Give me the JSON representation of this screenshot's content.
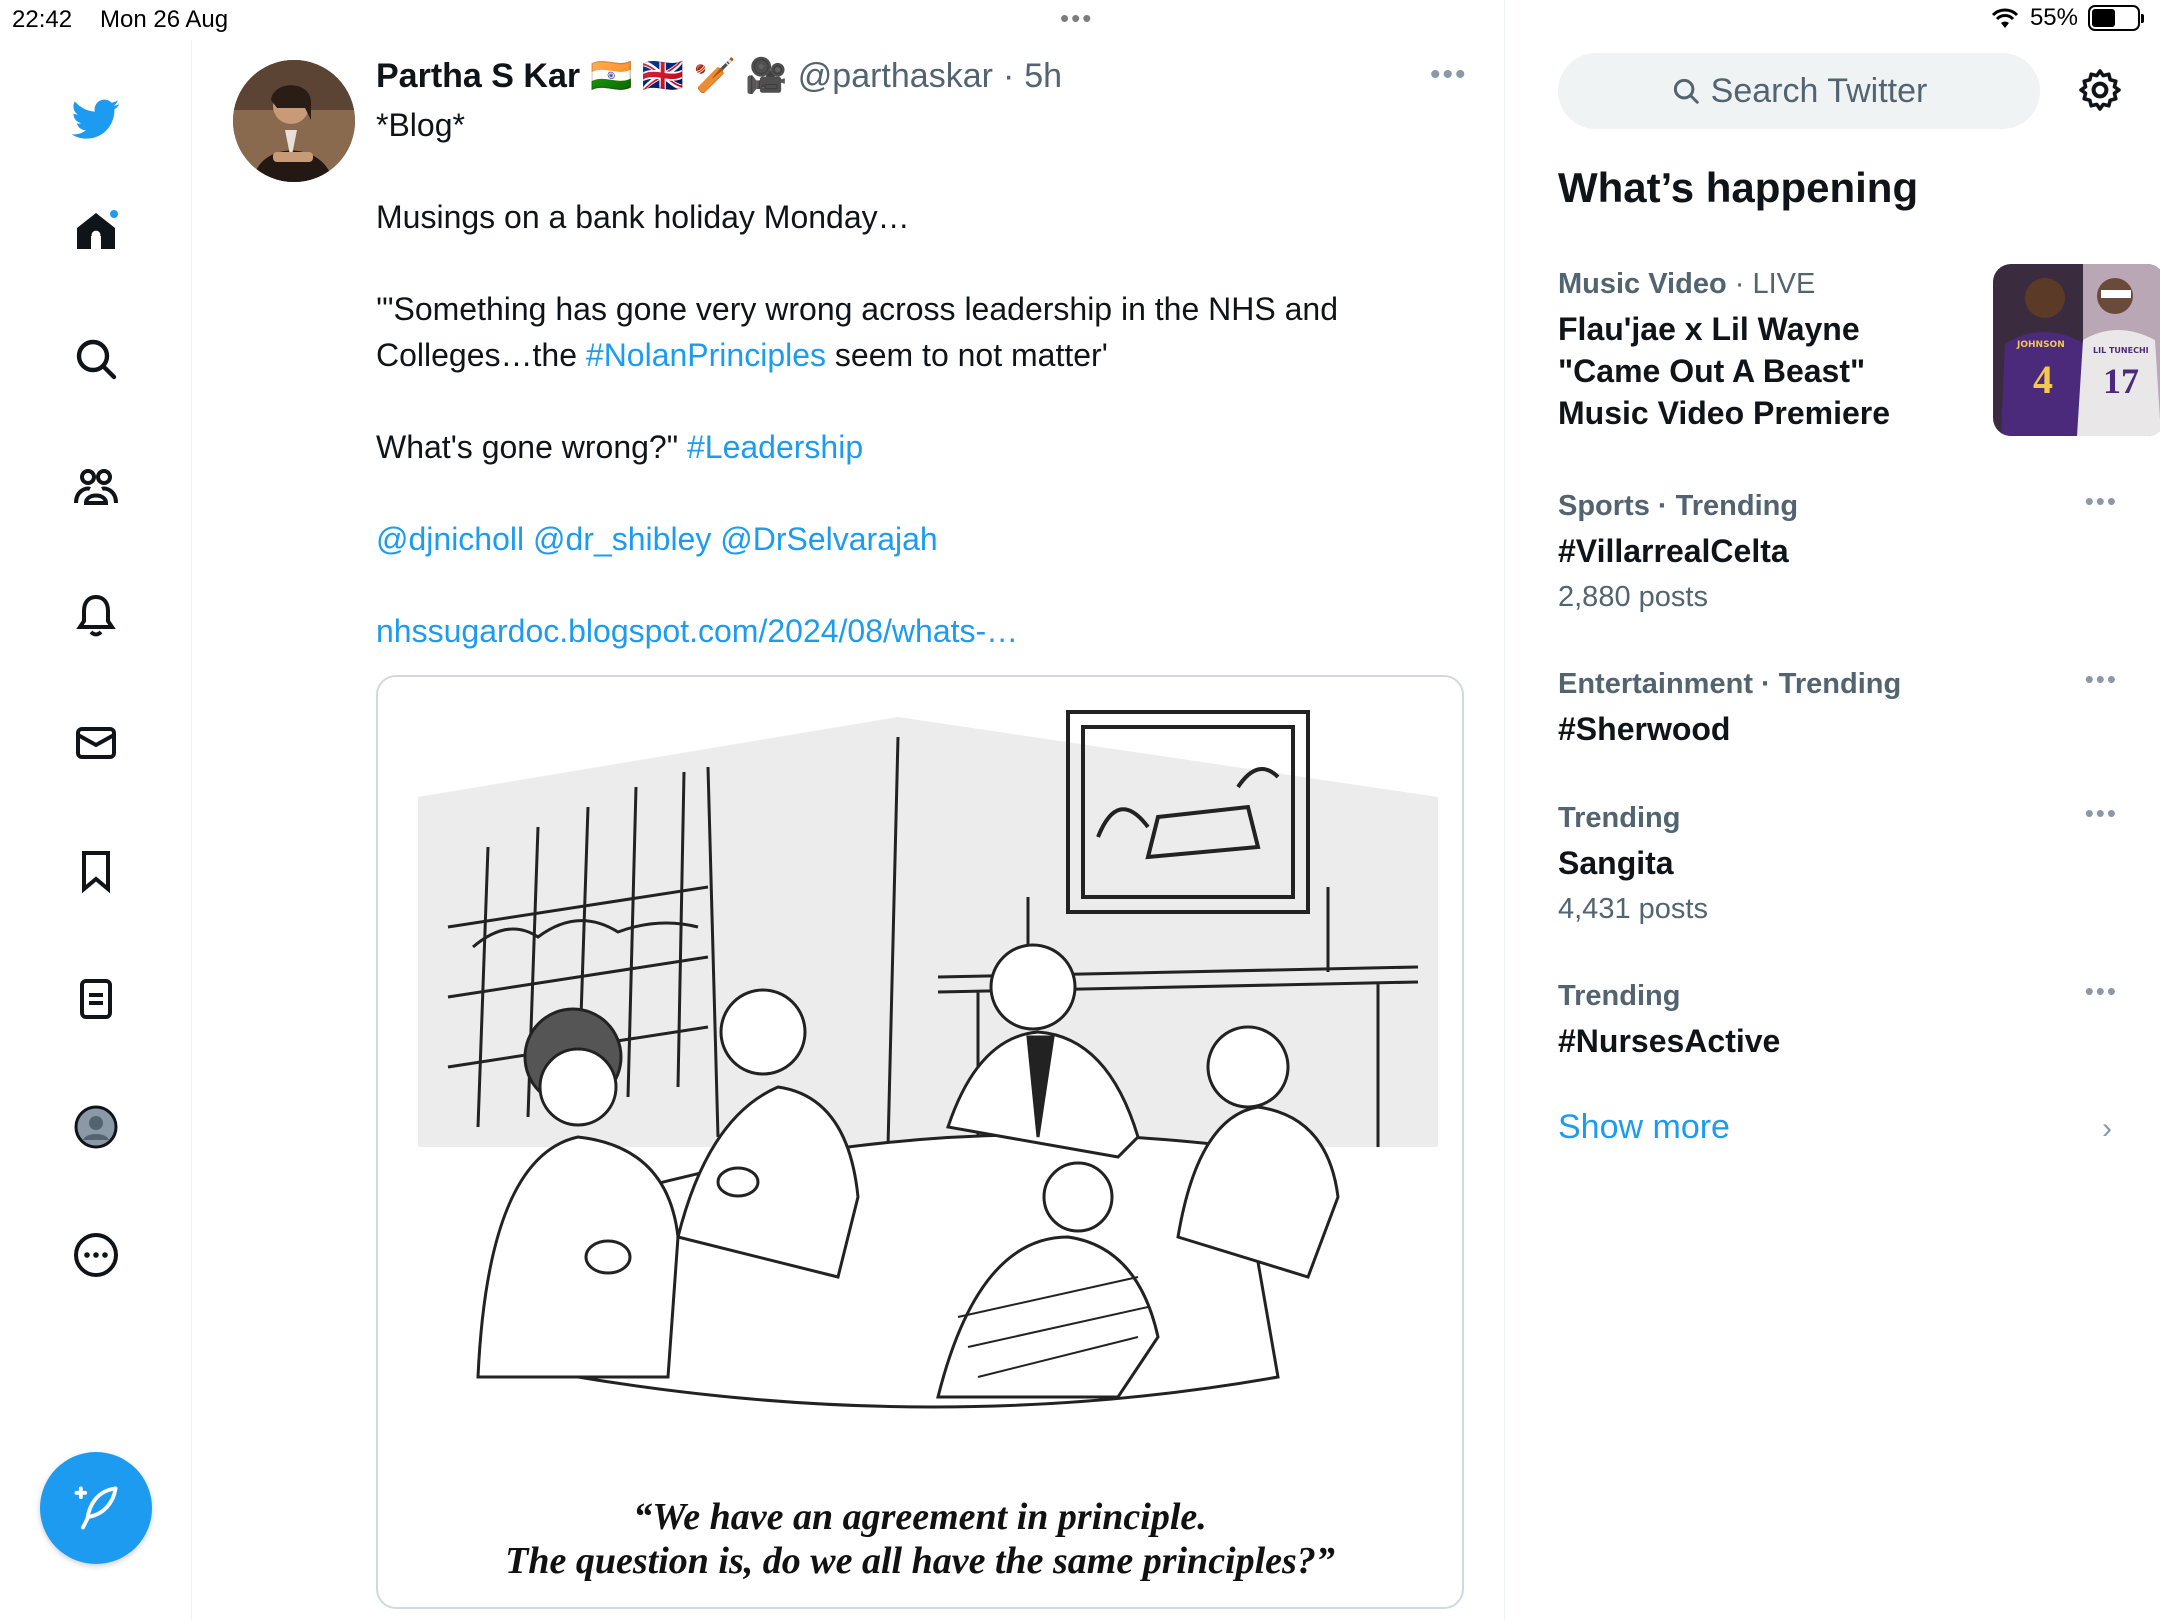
{
  "status_bar": {
    "time": "22:42",
    "date": "Mon 26 Aug",
    "battery": "55%",
    "battery_level": 0.55
  },
  "nav": {
    "items": [
      "twitter-logo",
      "home",
      "explore",
      "communities",
      "notifications",
      "messages",
      "bookmarks",
      "lists",
      "profile",
      "more"
    ],
    "compose_icon": "compose-feather-icon"
  },
  "tweet": {
    "author": "Partha S Kar",
    "emojis": "🇮🇳 🇬🇧 🏏 🎥",
    "handle": "@parthaskar",
    "separator": "·",
    "time": "5h",
    "line1": "*Blog*",
    "line2": "Musings on a bank holiday Monday…",
    "quote_start": "'\"Something has gone very wrong across leadership in the NHS and Colleges…the ",
    "hashtag_nolan": "#NolanPrinciples",
    "quote_end": " seem to not matter'",
    "question": "What's gone wrong?\" ",
    "hashtag_leadership": "#Leadership",
    "mentions": "@djnicholl @dr_shibley @DrSelvarajah",
    "url": "nhssugardoc.blogspot.com/2024/08/whats-…",
    "image_caption_line1": "“We have an agreement in principle.",
    "image_caption_line2": "The question is, do we all have the same principles?”"
  },
  "sidebar": {
    "search_placeholder": "Search Twitter",
    "section_title": "What’s happening",
    "trends": [
      {
        "category": "Music Video",
        "context": "· LIVE",
        "title": "Flau'jae x Lil Wayne \"Came Out A Beast\" Music Video Premiere",
        "count": ""
      },
      {
        "category": "Sports · Trending",
        "context": "",
        "title": "#VillarrealCelta",
        "count": "2,880 posts"
      },
      {
        "category": "Entertainment · Trending",
        "context": "",
        "title": "#Sherwood",
        "count": ""
      },
      {
        "category": "Trending",
        "context": "",
        "title": "Sangita",
        "count": "4,431 posts"
      },
      {
        "category": "Trending",
        "context": "",
        "title": "#NursesActive",
        "count": ""
      }
    ],
    "show_more": "Show more",
    "trend_image_jersey_left": "4",
    "trend_image_jersey_right": "17",
    "trend_image_name_left": "JOHNSON",
    "trend_image_name_right": "LIL TUNECHI"
  },
  "colors": {
    "accent": "#1d9bf0",
    "text": "#0f1419",
    "secondary": "#536471",
    "border": "#cfd9de"
  }
}
